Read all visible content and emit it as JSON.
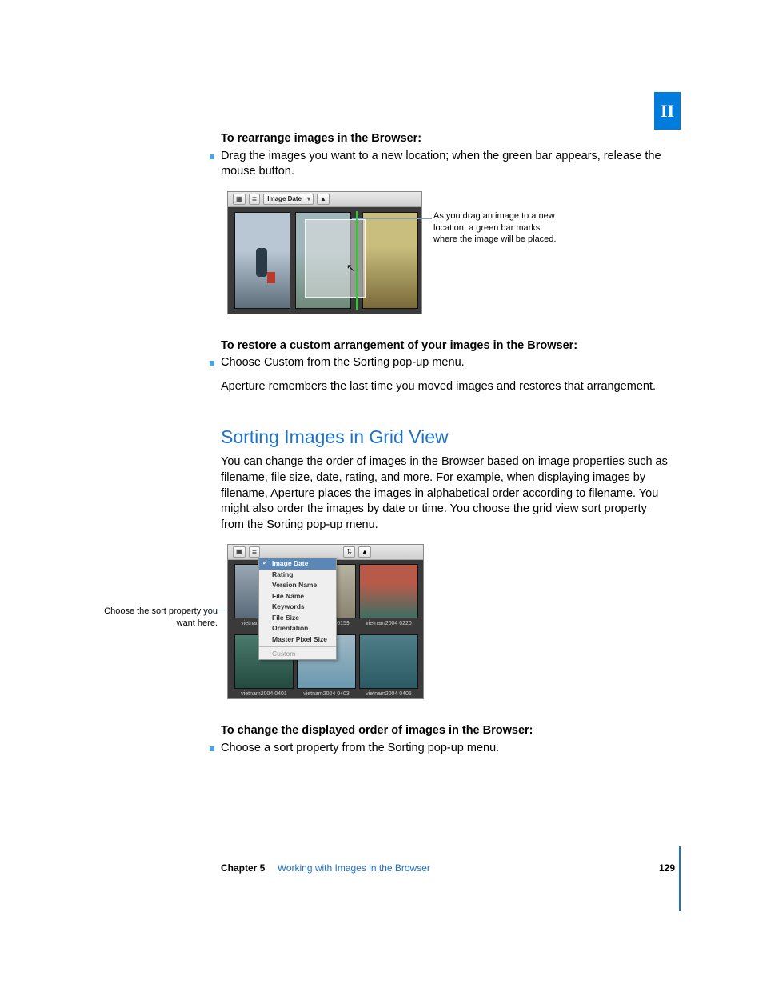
{
  "part_label": "II",
  "section1": {
    "lead": "To rearrange images in the Browser:",
    "bullet": "Drag the images you want to a new location; when the green bar appears, release the mouse button."
  },
  "fig1": {
    "toolbar_select": "Image Date",
    "callout": "As you drag an image to a new location, a green bar marks where the image will be placed."
  },
  "section2": {
    "lead": "To restore a custom arrangement of your images in the Browser:",
    "bullet": "Choose Custom from the Sorting pop-up menu.",
    "after": "Aperture remembers the last time you moved images and restores that arrangement."
  },
  "heading": "Sorting Images in Grid View",
  "intro": "You can change the order of images in the Browser based on image properties such as filename, file size, date, rating, and more. For example, when displaying images by filename, Aperture places the images in alphabetical order according to filename. You might also order the images by date or time. You choose the grid view sort property from the Sorting pop-up menu.",
  "fig2": {
    "callout": "Choose the sort property you want here.",
    "menu": {
      "selected": "Image Date",
      "items": [
        "Rating",
        "Version Name",
        "File Name",
        "Keywords",
        "File Size",
        "Orientation",
        "Master Pixel Size"
      ],
      "custom": "Custom"
    },
    "labels": [
      "vietnam2004 0157",
      "vietnam2004 0159",
      "vietnam2004 0220",
      "vietnam2004 0401",
      "vietnam2004 0403",
      "vietnam2004 0405"
    ]
  },
  "section3": {
    "lead": "To change the displayed order of images in the Browser:",
    "bullet": "Choose a sort property from the Sorting pop-up menu."
  },
  "footer": {
    "chapter": "Chapter 5",
    "title": "Working with Images in the Browser",
    "page": "129"
  }
}
